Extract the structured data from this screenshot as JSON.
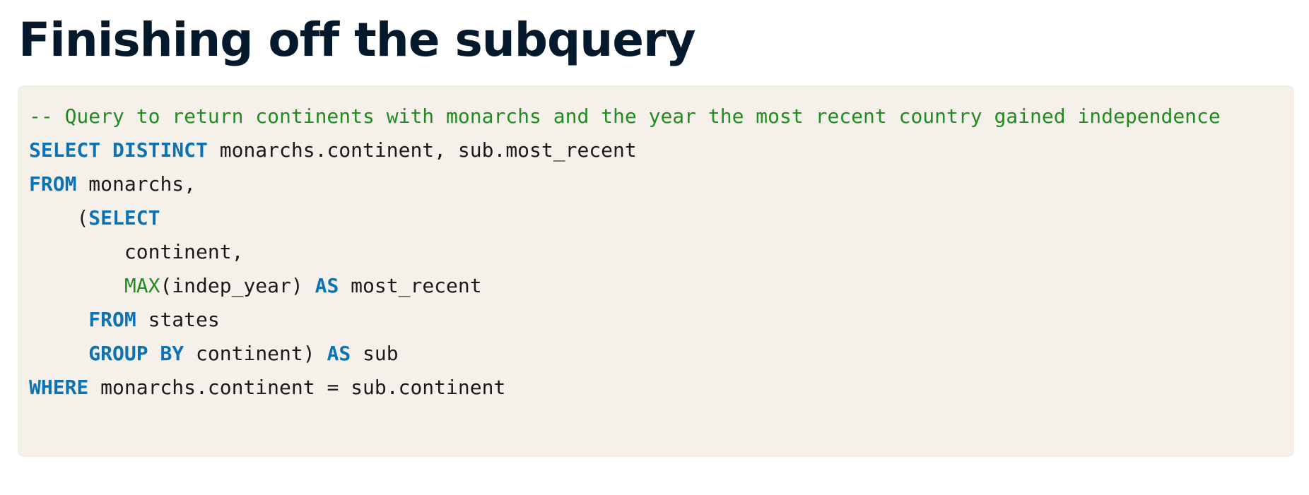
{
  "title": "Finishing off the subquery",
  "code": {
    "comment": "-- Query to return continents with monarchs and the year the most recent country gained independence",
    "line2": {
      "kw1": "SELECT",
      "kw2": "DISTINCT",
      "rest": "monarchs.continent, sub.most_recent"
    },
    "line3": {
      "kw": "FROM",
      "rest": "monarchs,"
    },
    "line4": {
      "paren": "(",
      "kw": "SELECT"
    },
    "line5": {
      "text": "continent,"
    },
    "line6": {
      "fn": "MAX",
      "arg": "(indep_year)",
      "kw": "AS",
      "rest": "most_recent"
    },
    "line7": {
      "kw": "FROM",
      "rest": "states"
    },
    "line8": {
      "kw1": "GROUP",
      "kw2": "BY",
      "mid": "continent)",
      "kw3": "AS",
      "rest": "sub"
    },
    "line9": {
      "kw": "WHERE",
      "rest": "monarchs.continent = sub.continent"
    }
  }
}
